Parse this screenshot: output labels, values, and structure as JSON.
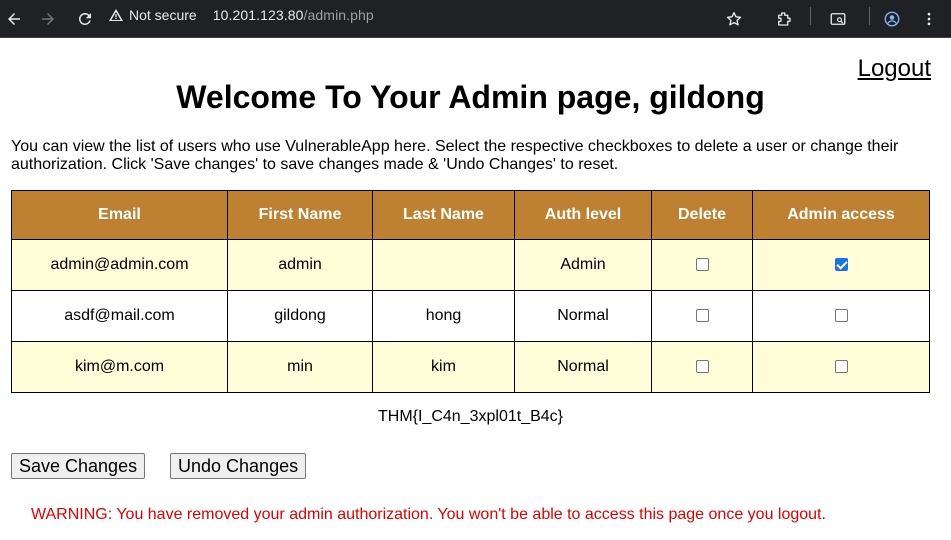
{
  "browser": {
    "security_label": "Not secure",
    "url_host": "10.201.123.80",
    "url_path": "/admin.php"
  },
  "page": {
    "logout_label": "Logout",
    "title": "Welcome To Your Admin page, gildong",
    "intro": "You can view the list of users who use VulnerableApp here. Select the respective checkboxes to delete a user or change their authorization. Click 'Save changes' to save changes made & 'Undo Changes' to reset.",
    "flag": "THM{I_C4n_3xpl01t_B4c}",
    "save_label": "Save Changes",
    "undo_label": "Undo Changes",
    "warning": "WARNING: You have removed your admin authorization. You won't be able to access this page once you logout."
  },
  "table": {
    "headers": [
      "Email",
      "First Name",
      "Last Name",
      "Auth level",
      "Delete",
      "Admin access"
    ],
    "rows": [
      {
        "email": "admin@admin.com",
        "first": "admin",
        "last": "",
        "auth": "Admin",
        "delete": false,
        "admin": true
      },
      {
        "email": "asdf@mail.com",
        "first": "gildong",
        "last": "hong",
        "auth": "Normal",
        "delete": false,
        "admin": false
      },
      {
        "email": "kim@m.com",
        "first": "min",
        "last": "kim",
        "auth": "Normal",
        "delete": false,
        "admin": false
      }
    ]
  },
  "colors": {
    "header_bg": "#be8132",
    "row_alt_bg": "#fffed8",
    "warning": "#e00000"
  },
  "icons": [
    "back-arrow-icon",
    "forward-arrow-icon",
    "reload-icon",
    "warning-triangle-icon",
    "star-icon",
    "extensions-icon",
    "tab-search-icon",
    "profile-icon",
    "menu-icon"
  ]
}
